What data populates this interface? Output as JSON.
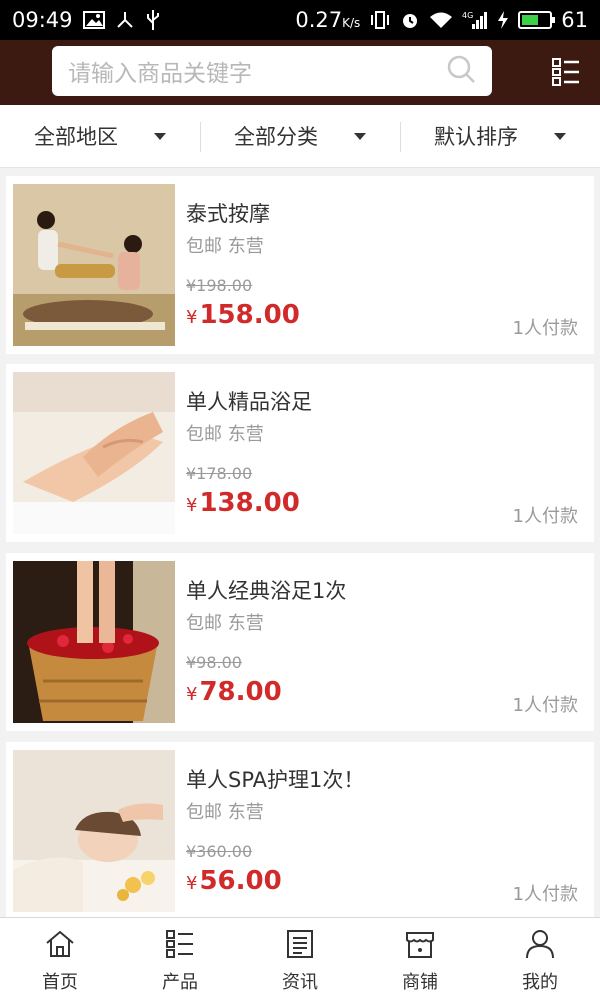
{
  "status_bar": {
    "time": "09:49",
    "speed": "0.27",
    "speed_unit": "K/s",
    "network": "4G",
    "battery": "61"
  },
  "search": {
    "placeholder": "请输入商品关键字"
  },
  "filters": [
    {
      "label": "全部地区"
    },
    {
      "label": "全部分类"
    },
    {
      "label": "默认排序"
    }
  ],
  "products": [
    {
      "name": "泰式按摩",
      "shipping": "包邮 东营",
      "original_price": "¥198.00",
      "currency": "¥",
      "price": "158.00",
      "sold": "1人付款"
    },
    {
      "name": "单人精品浴足",
      "shipping": "包邮 东营",
      "original_price": "¥178.00",
      "currency": "¥",
      "price": "138.00",
      "sold": "1人付款"
    },
    {
      "name": "单人经典浴足1次",
      "shipping": "包邮 东营",
      "original_price": "¥98.00",
      "currency": "¥",
      "price": "78.00",
      "sold": "1人付款"
    },
    {
      "name": "单人SPA护理1次！",
      "shipping": "包邮 东营",
      "original_price": "¥360.00",
      "currency": "¥",
      "price": "56.00",
      "sold": "1人付款"
    }
  ],
  "tabs": [
    {
      "label": "首页",
      "icon": "home-icon"
    },
    {
      "label": "产品",
      "icon": "list-icon"
    },
    {
      "label": "资讯",
      "icon": "news-icon"
    },
    {
      "label": "商铺",
      "icon": "shop-icon"
    },
    {
      "label": "我的",
      "icon": "user-icon"
    }
  ],
  "colors": {
    "header": "#3c1a12",
    "price": "#d02a2a"
  }
}
